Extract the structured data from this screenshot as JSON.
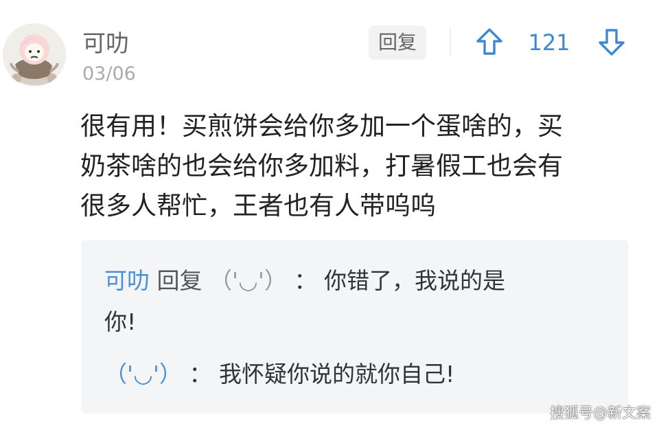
{
  "comment": {
    "username": "可叻",
    "date": "03/06",
    "reply_label": "回复",
    "vote_count": "121",
    "body_lines": [
      "很有用！买煎饼会给你多加一个蛋啥的，买",
      "奶茶啥的也会给你多加料，打暑假工也会有",
      "很多人帮忙，王者也有人带呜呜"
    ]
  },
  "replies": {
    "first": {
      "author": "可叻",
      "action": "回复",
      "target": "（'◡'）",
      "separator": "：",
      "text_line1": "你错了，我说的是",
      "text_line2": "你!"
    },
    "second": {
      "author": "（'◡'）",
      "separator": "：",
      "text": "我怀疑你说的就你自己!"
    }
  },
  "watermark": "搜狐号@新文案",
  "colors": {
    "accent_blue": "#4a90d4",
    "username_gray": "#666666",
    "date_gray": "#aaaaaa",
    "reply_background": "#f4f5f7"
  },
  "icons": {
    "avatar": "cartoon-avatar",
    "upvote": "upvote-arrow-icon",
    "downvote": "downvote-arrow-icon"
  }
}
